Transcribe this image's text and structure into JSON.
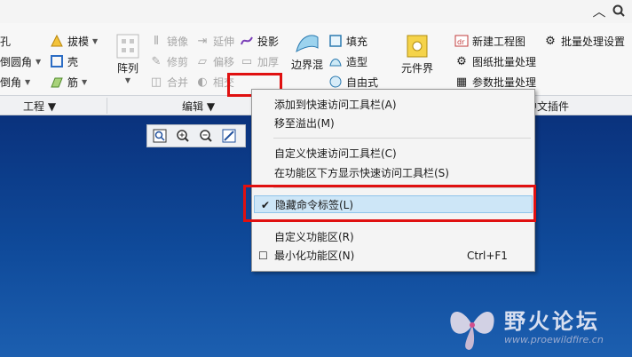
{
  "window_controls": {
    "up_icon": "caret-up-icon",
    "search_icon": "search-icon"
  },
  "ribbon": {
    "col1": [
      {
        "label": "孔",
        "dropdown": false
      },
      {
        "label": "倒圆角",
        "dropdown": true
      },
      {
        "label": "倒角",
        "dropdown": true
      }
    ],
    "col2": [
      {
        "label": "拔模",
        "dropdown": true
      },
      {
        "label": "壳",
        "dropdown": false
      },
      {
        "label": "筋",
        "dropdown": true
      }
    ],
    "array_label": "阵列",
    "edit_col1": [
      {
        "label": "镜像"
      },
      {
        "label": "修剪"
      },
      {
        "label": "合并"
      }
    ],
    "edit_col2": [
      {
        "label": "延伸"
      },
      {
        "label": "偏移"
      },
      {
        "label": "相交"
      }
    ],
    "edit_col3": [
      {
        "label": "投影"
      },
      {
        "label": "加厚"
      }
    ],
    "boundary_label": "边界混合",
    "surface_col": [
      {
        "label": "填充"
      },
      {
        "label": "造型"
      },
      {
        "label": "自由式"
      }
    ],
    "component_label": "元件界面",
    "plugin_col": [
      {
        "label": "新建工程图"
      },
      {
        "label": "图纸批量处理"
      },
      {
        "label": "参数批量处理"
      }
    ],
    "batch_settings_label": "批量处理设置",
    "groups": [
      {
        "label": "工程 ▼"
      },
      {
        "label": "编辑 ▼"
      },
      {
        "label": "中文插件"
      }
    ]
  },
  "view_toolbar": [
    "zoom-fit-icon",
    "zoom-in-icon",
    "zoom-out-icon",
    "repaint-icon"
  ],
  "context_menu": {
    "items": [
      {
        "label": "添加到快速访问工具栏(A)",
        "checked": false,
        "shortcut": ""
      },
      {
        "label": "移至溢出(M)",
        "checked": false,
        "shortcut": ""
      },
      {
        "label": "自定义快速访问工具栏(C)",
        "checked": false,
        "shortcut": ""
      },
      {
        "label": "在功能区下方显示快速访问工具栏(S)",
        "checked": false,
        "shortcut": ""
      },
      {
        "label": "隐藏命令标签(L)",
        "checked": true,
        "shortcut": ""
      },
      {
        "label": "自定义功能区(R)",
        "checked": false,
        "shortcut": ""
      },
      {
        "label": "最小化功能区(N)",
        "checked": false,
        "shortcut": "Ctrl+F1"
      }
    ]
  },
  "watermark": {
    "title": "野火论坛",
    "url": "www.proewildfire.cn"
  },
  "colors": {
    "highlight": "#cde6f7",
    "red_box": "#e01010",
    "canvas_top": "#0a327d",
    "canvas_bottom": "#1c5fb0"
  }
}
